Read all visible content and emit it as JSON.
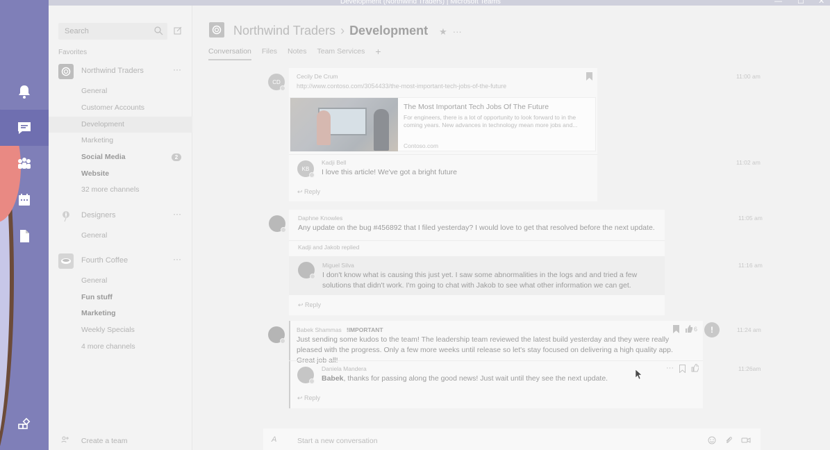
{
  "window": {
    "title": "Development (Northwind Traders) | Microsoft Teams"
  },
  "rail": {
    "items": [
      {
        "name": "activity",
        "icon": "bell-icon"
      },
      {
        "name": "chat",
        "icon": "chat-icon",
        "active": true
      },
      {
        "name": "teams",
        "icon": "teams-icon"
      },
      {
        "name": "meetings",
        "icon": "calendar-icon"
      },
      {
        "name": "files",
        "icon": "file-icon"
      },
      {
        "name": "apps",
        "icon": "apps-icon"
      }
    ]
  },
  "sidebar": {
    "search_placeholder": "Search",
    "favorites_label": "Favorites",
    "teams": [
      {
        "name": "Northwind Traders",
        "more": "···",
        "channels": [
          {
            "label": "General"
          },
          {
            "label": "Customer Accounts"
          },
          {
            "label": "Development",
            "active": true
          },
          {
            "label": "Marketing"
          },
          {
            "label": "Social Media",
            "bold": true,
            "badge": "2"
          },
          {
            "label": "Website",
            "bold": true
          },
          {
            "label": "32 more channels"
          }
        ]
      },
      {
        "name": "Designers",
        "more": "···",
        "channels": [
          {
            "label": "General"
          }
        ]
      },
      {
        "name": "Fourth Coffee",
        "more": "···",
        "channels": [
          {
            "label": "General"
          },
          {
            "label": "Fun stuff",
            "bold": true
          },
          {
            "label": "Marketing",
            "bold": true
          },
          {
            "label": "Weekly Specials"
          },
          {
            "label": "4 more channels"
          }
        ]
      }
    ],
    "create_team": "Create a team"
  },
  "header": {
    "team": "Northwind Traders",
    "separator": "›",
    "channel": "Development",
    "star": "★",
    "more": "···",
    "tabs": [
      "Conversation",
      "Files",
      "Notes",
      "Team Services"
    ],
    "add_tab": "+"
  },
  "threads": [
    {
      "author": "Cecily De Crum",
      "initials": "CD",
      "time": "11:00 am",
      "link": "http://www.contoso.com/3054433/the-most-important-tech-jobs-of-the-future",
      "preview": {
        "title": "The Most Important Tech Jobs Of The Future",
        "desc": "For engineers, there is a lot of opportunity to look forward to in the coming years. New advances in technology mean more jobs and...",
        "source": "Contoso.com"
      },
      "reply_author": "Kadji Bell",
      "reply_initials": "KB",
      "reply_text": "I love this article! We've got a bright future",
      "reply_time": "11:02 am",
      "reply_label": "Reply"
    },
    {
      "author": "Daphne Knowles",
      "time": "11:05 am",
      "text": "Any update on the bug #456892 that I filed yesterday? I would love to get that resolved before the next update.",
      "replied": "Kadji and Jakob replied",
      "reply_author": "Miguel Silva",
      "reply_text": "I don't know what is causing this just yet. I saw some abnormalities in the logs and and tried a few solutions that didn't work. I'm going to chat with Jakob to see what other information we can get.",
      "reply_time": "11:16 am",
      "reply_label": "Reply"
    },
    {
      "author": "Babek Shammas",
      "flag": "!IMPORTANT",
      "time": "11:24 am",
      "likes": "6",
      "important_badge": "!",
      "text": "Just sending some kudos to the team! The leadership team reviewed the latest build yesterday and they were really pleased with the progress. Only a few more weeks until release so let's stay focused on delivering a high quality app. Great job all!",
      "reply_author": "Daniela Mandera",
      "reply_mention": "Babek",
      "reply_text": ", thanks for passing along the good news! Just wait until they see the next update.",
      "reply_time": "11:26am",
      "reply_more": "···",
      "reply_label": "Reply"
    }
  ],
  "compose": {
    "placeholder": "Start a new conversation",
    "format_icon": "A"
  }
}
